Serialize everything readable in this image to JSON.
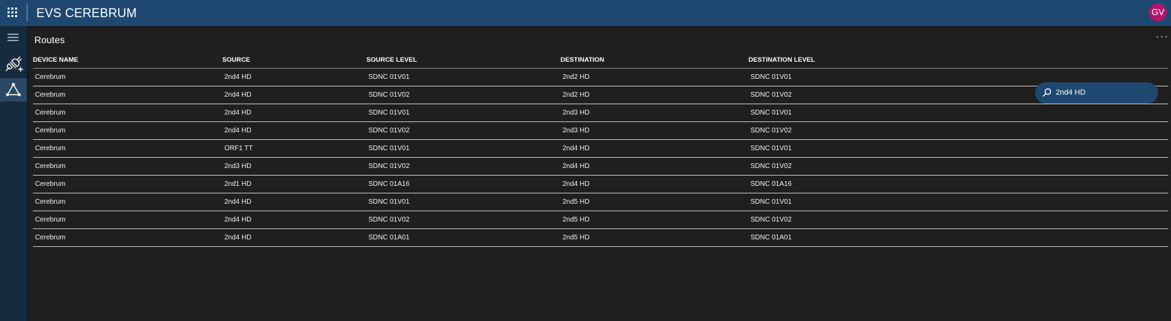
{
  "app": {
    "title": "EVS CEREBRUM",
    "user_initials": "GV",
    "brand_color": "#1e4870",
    "avatar_color": "#b4136e"
  },
  "sidebar": {
    "items": [
      {
        "icon": "hamburger-menu-icon"
      },
      {
        "icon": "plug-add-icon"
      },
      {
        "icon": "routes-triangle-icon",
        "active": true
      }
    ]
  },
  "panel": {
    "title": "Routes",
    "more_label": "···"
  },
  "table": {
    "columns": [
      "DEVICE NAME",
      "SOURCE",
      "SOURCE LEVEL",
      "DESTINATION",
      "DESTINATION LEVEL"
    ],
    "rows": [
      [
        "Cerebrum",
        "2nd4 HD",
        "SDNC 01V01",
        "2nd2 HD",
        "SDNC 01V01"
      ],
      [
        "Cerebrum",
        "2nd4 HD",
        "SDNC 01V02",
        "2nd2 HD",
        "SDNC 01V02"
      ],
      [
        "Cerebrum",
        "2nd4 HD",
        "SDNC 01V01",
        "2nd3 HD",
        "SDNC 01V01"
      ],
      [
        "Cerebrum",
        "2nd4 HD",
        "SDNC 01V02",
        "2nd3 HD",
        "SDNC 01V02"
      ],
      [
        "Cerebrum",
        "ORF1 TT",
        "SDNC 01V01",
        "2nd4 HD",
        "SDNC 01V01"
      ],
      [
        "Cerebrum",
        "2nd3 HD",
        "SDNC 01V02",
        "2nd4 HD",
        "SDNC 01V02"
      ],
      [
        "Cerebrum",
        "2nd1 HD",
        "SDNC 01A16",
        "2nd4 HD",
        "SDNC 01A16"
      ],
      [
        "Cerebrum",
        "2nd4 HD",
        "SDNC 01V01",
        "2nd5 HD",
        "SDNC 01V01"
      ],
      [
        "Cerebrum",
        "2nd4 HD",
        "SDNC 01V02",
        "2nd5 HD",
        "SDNC 01V02"
      ],
      [
        "Cerebrum",
        "2nd4 HD",
        "SDNC 01A01",
        "2nd5 HD",
        "SDNC 01A01"
      ]
    ]
  },
  "search": {
    "value": "2nd4 HD",
    "icon": "search-icon"
  }
}
